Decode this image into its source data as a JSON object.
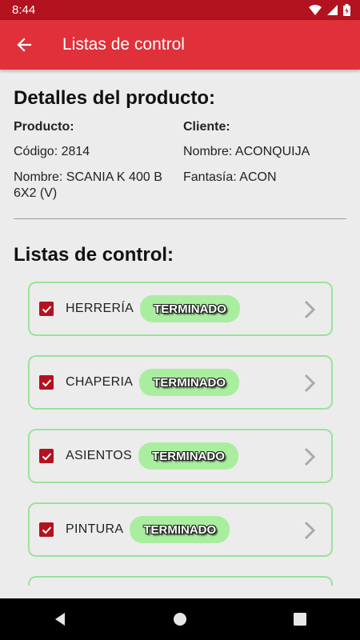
{
  "status_bar": {
    "time": "8:44"
  },
  "app_bar": {
    "title": "Listas de control"
  },
  "details": {
    "title": "Detalles del producto:",
    "product": {
      "heading": "Producto:",
      "code": "Código: 2814",
      "name": "Nombre: SCANIA K 400 B 6X2 (V)"
    },
    "client": {
      "heading": "Cliente:",
      "name": "Nombre: ACONQUIJA",
      "fantasy": "Fantasía: ACON"
    }
  },
  "lists": {
    "title": "Listas de control:",
    "items": [
      {
        "label": "HERRERÍA",
        "status": "TERMINADO",
        "checked": true
      },
      {
        "label": "CHAPERIA",
        "status": "TERMINADO",
        "checked": true
      },
      {
        "label": "ASIENTOS",
        "status": "TERMINADO",
        "checked": true
      },
      {
        "label": "PINTURA",
        "status": "TERMINADO",
        "checked": true
      }
    ]
  },
  "colors": {
    "status_bar": "#b3121f",
    "app_bar": "#e0303a",
    "card_border": "#9be39b",
    "badge": "#a9ee9f",
    "checkbox": "#b3121f"
  }
}
